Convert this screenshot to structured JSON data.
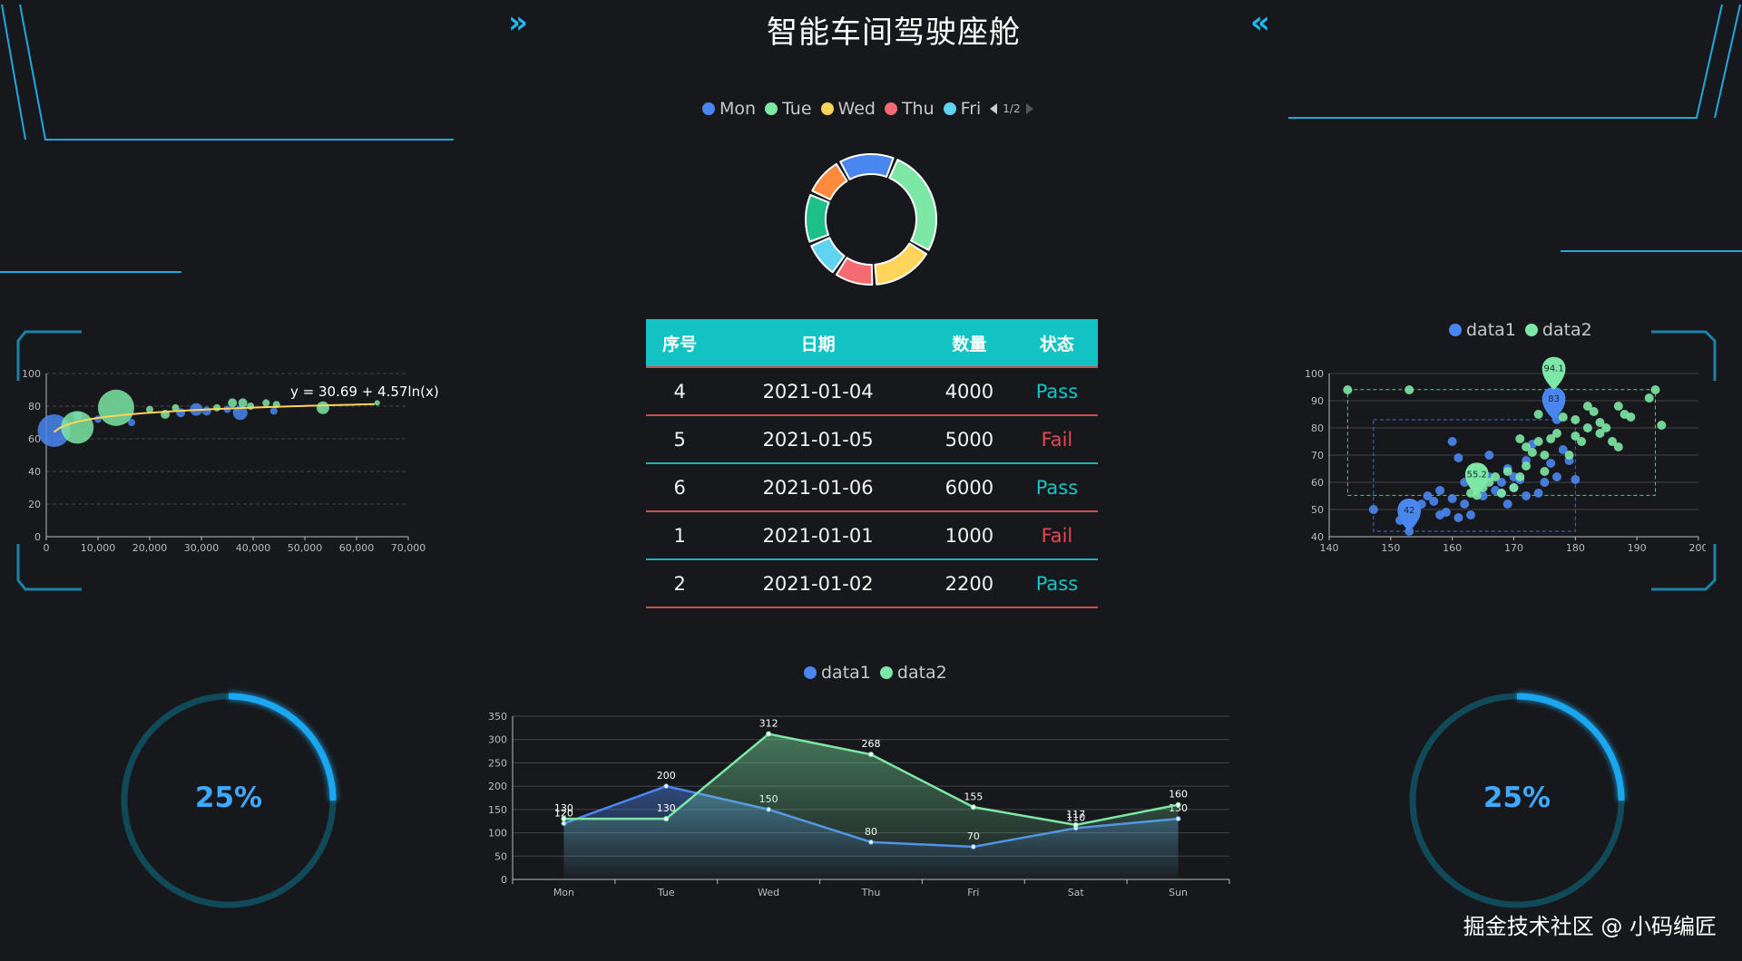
{
  "page": {
    "title": "智能车间驾驶座舱",
    "watermark": "掘金技术社区 @ 小码编匠"
  },
  "colors": {
    "background": "#17181c",
    "accent_cyan": "#13c2c2",
    "frame_line": "#1fa9e0",
    "blue": "#4a86f0",
    "green": "#7de8a5",
    "yellow": "#ffd45a",
    "red": "#f46b73",
    "orange": "#ff8a3d",
    "sky": "#5fd3ef",
    "teal": "#1fbf8a",
    "pass": "#16c5c5",
    "fail": "#e84855"
  },
  "icons": {
    "left_chevron": "double-chevron-right-icon",
    "right_chevron": "double-chevron-left-icon"
  },
  "donut": {
    "legend": [
      {
        "name": "Mon",
        "color": "#4a86f0"
      },
      {
        "name": "Tue",
        "color": "#7de8a5"
      },
      {
        "name": "Wed",
        "color": "#ffd45a"
      },
      {
        "name": "Thu",
        "color": "#f46b73"
      },
      {
        "name": "Fri",
        "color": "#5fd3ef"
      }
    ],
    "pager": "1/2"
  },
  "table": {
    "headers": [
      "序号",
      "日期",
      "数量",
      "状态"
    ],
    "rows": [
      {
        "id": "4",
        "date": "2021-01-04",
        "qty": "4000",
        "status": "Pass"
      },
      {
        "id": "5",
        "date": "2021-01-05",
        "qty": "5000",
        "status": "Fail"
      },
      {
        "id": "6",
        "date": "2021-01-06",
        "qty": "6000",
        "status": "Pass"
      },
      {
        "id": "1",
        "date": "2021-01-01",
        "qty": "1000",
        "status": "Fail"
      },
      {
        "id": "2",
        "date": "2021-01-02",
        "qty": "2200",
        "status": "Pass"
      }
    ]
  },
  "gauges": {
    "left_value": "25%",
    "right_value": "25%",
    "fraction": 0.25
  },
  "chart_data": [
    {
      "id": "bubble-regression",
      "type": "scatter",
      "annotation": "y = 30.69 + 4.57ln(x)",
      "xlim": [
        0,
        70000
      ],
      "ylim": [
        0,
        100
      ],
      "x_ticks": [
        "0",
        "10,000",
        "20,000",
        "30,000",
        "40,000",
        "50,000",
        "60,000",
        "70,000"
      ],
      "y_ticks": [
        "0",
        "20",
        "40",
        "60",
        "80",
        "100"
      ],
      "regression": {
        "a": 30.69,
        "b": 4.57
      },
      "series": [
        {
          "color": "#4a86f0",
          "points": [
            [
              1500,
              65,
              18
            ],
            [
              16500,
              70,
              4
            ],
            [
              26000,
              76,
              5
            ],
            [
              29000,
              78,
              7
            ],
            [
              31000,
              77,
              5
            ],
            [
              35000,
              78,
              4
            ],
            [
              37500,
              76,
              8
            ],
            [
              44000,
              77,
              4
            ],
            [
              6000,
              74,
              5
            ],
            [
              10000,
              72,
              4
            ]
          ]
        },
        {
          "color": "#7de8a5",
          "points": [
            [
              6000,
              67,
              18
            ],
            [
              13500,
              79,
              20
            ],
            [
              20000,
              78,
              4
            ],
            [
              23000,
              75,
              5
            ],
            [
              25000,
              79,
              4
            ],
            [
              33000,
              79,
              4
            ],
            [
              36000,
              82,
              5
            ],
            [
              38000,
              82,
              5
            ],
            [
              39500,
              80,
              4
            ],
            [
              42500,
              82,
              4
            ],
            [
              44500,
              81,
              4
            ],
            [
              53500,
              79,
              7
            ],
            [
              64000,
              82,
              3
            ]
          ]
        }
      ]
    },
    {
      "id": "scatter-height-weight",
      "type": "scatter",
      "legend": [
        "data1",
        "data2"
      ],
      "xlim": [
        140,
        200
      ],
      "ylim": [
        40,
        100
      ],
      "x_ticks": [
        "140",
        "150",
        "160",
        "170",
        "180",
        "190",
        "200"
      ],
      "y_ticks": [
        "40",
        "50",
        "60",
        "70",
        "80",
        "90",
        "100"
      ],
      "series": [
        {
          "name": "data1",
          "color": "#4a86f0",
          "marker_labels": [
            {
              "label": "83",
              "x": 176.5,
              "y": 83
            },
            {
              "label": "42",
              "x": 153,
              "y": 42
            }
          ],
          "mark_area": {
            "x": [
              147.2,
              180
            ],
            "y": [
              42,
              83
            ]
          },
          "points": [
            [
              147.2,
              50
            ],
            [
              151.5,
              46
            ],
            [
              152.5,
              48
            ],
            [
              153,
              42
            ],
            [
              153.5,
              50
            ],
            [
              154,
              49
            ],
            [
              155,
              52
            ],
            [
              156,
              55
            ],
            [
              157,
              53
            ],
            [
              158,
              48
            ],
            [
              158,
              57
            ],
            [
              159,
              49
            ],
            [
              160,
              54
            ],
            [
              160,
              75
            ],
            [
              161,
              69
            ],
            [
              161,
              47
            ],
            [
              162,
              60
            ],
            [
              162,
              52
            ],
            [
              163,
              63
            ],
            [
              163,
              48
            ],
            [
              164,
              58
            ],
            [
              165,
              60
            ],
            [
              165,
              55
            ],
            [
              166,
              62
            ],
            [
              166,
              70
            ],
            [
              167,
              57
            ],
            [
              168,
              56
            ],
            [
              168,
              60
            ],
            [
              169,
              52
            ],
            [
              169,
              65
            ],
            [
              170,
              58
            ],
            [
              170,
              62
            ],
            [
              171,
              61
            ],
            [
              172,
              68
            ],
            [
              172,
              55
            ],
            [
              173,
              74
            ],
            [
              174,
              56
            ],
            [
              175,
              60
            ],
            [
              176,
              67
            ],
            [
              177,
              62
            ],
            [
              177,
              83
            ],
            [
              178,
              72
            ],
            [
              179,
              68
            ],
            [
              180,
              61
            ]
          ]
        },
        {
          "name": "data2",
          "color": "#7de8a5",
          "marker_labels": [
            {
              "label": "94.1",
              "x": 176.5,
              "y": 94.1
            },
            {
              "label": "55.2",
              "x": 164,
              "y": 55.2
            }
          ],
          "mark_area": {
            "x": [
              143,
              193
            ],
            "y": [
              55.2,
              94.1
            ]
          },
          "points": [
            [
              143,
              94
            ],
            [
              153,
              94
            ],
            [
              163,
              56
            ],
            [
              164,
              55.2
            ],
            [
              165,
              58
            ],
            [
              166,
              60
            ],
            [
              167,
              62
            ],
            [
              168,
              56
            ],
            [
              169,
              64
            ],
            [
              170,
              58
            ],
            [
              171,
              62
            ],
            [
              171,
              76
            ],
            [
              172,
              66
            ],
            [
              172,
              73
            ],
            [
              173,
              71
            ],
            [
              174,
              75
            ],
            [
              174,
              85
            ],
            [
              175,
              64
            ],
            [
              175,
              70
            ],
            [
              176,
              76
            ],
            [
              177,
              78
            ],
            [
              177,
              87
            ],
            [
              178,
              84
            ],
            [
              179,
              70
            ],
            [
              180,
              77
            ],
            [
              180,
              83
            ],
            [
              181,
              75
            ],
            [
              182,
              80
            ],
            [
              182,
              88
            ],
            [
              183,
              86
            ],
            [
              184,
              82
            ],
            [
              184,
              78
            ],
            [
              185,
              80
            ],
            [
              186,
              75
            ],
            [
              187,
              88
            ],
            [
              187,
              73
            ],
            [
              188,
              85
            ],
            [
              189,
              84
            ],
            [
              192,
              91
            ],
            [
              193,
              94
            ],
            [
              194,
              81
            ]
          ]
        }
      ]
    },
    {
      "id": "area-weekly",
      "type": "area",
      "legend": [
        "data1",
        "data2"
      ],
      "categories": [
        "Mon",
        "Tue",
        "Wed",
        "Thu",
        "Fri",
        "Sat",
        "Sun"
      ],
      "ylim": [
        0,
        350
      ],
      "y_ticks": [
        "0",
        "50",
        "100",
        "150",
        "200",
        "250",
        "300",
        "350"
      ],
      "series": [
        {
          "name": "data1",
          "color": "#4a86f0",
          "values": [
            120,
            200,
            150,
            80,
            70,
            110,
            130
          ]
        },
        {
          "name": "data2",
          "color": "#7de8a5",
          "values": [
            130,
            130,
            312,
            268,
            155,
            117,
            160
          ]
        }
      ]
    }
  ]
}
